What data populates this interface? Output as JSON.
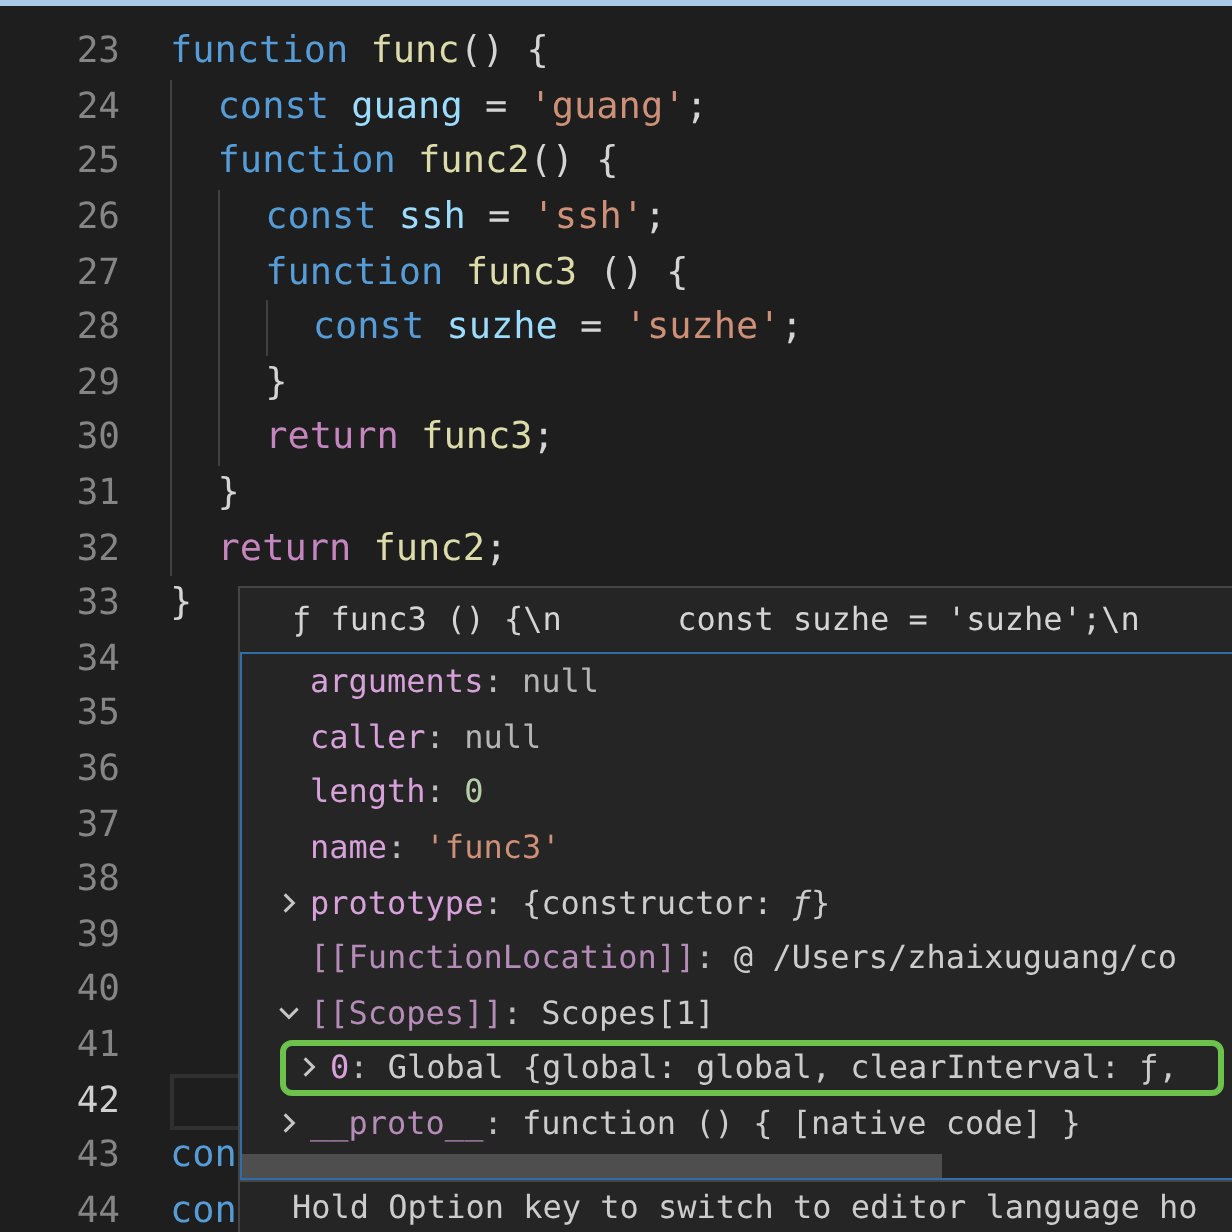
{
  "editor": {
    "lines": [
      {
        "number": "23",
        "current": false,
        "tokens": [
          {
            "text": "function",
            "kind": "keyword"
          },
          {
            "text": " func",
            "kind": "function"
          },
          {
            "text": "() {",
            "kind": "plain"
          }
        ],
        "children": [
          {
            "number": "24",
            "current": false,
            "tokens": [
              {
                "text": "const",
                "kind": "keyword"
              },
              {
                "text": " guang",
                "kind": "variable"
              },
              {
                "text": " = ",
                "kind": "plain"
              },
              {
                "text": "'guang'",
                "kind": "string"
              },
              {
                "text": ";",
                "kind": "plain"
              }
            ]
          },
          {
            "number": "25",
            "current": false,
            "tokens": [
              {
                "text": "function",
                "kind": "keyword"
              },
              {
                "text": " func2",
                "kind": "function"
              },
              {
                "text": "() {",
                "kind": "plain"
              }
            ],
            "children": [
              {
                "number": "26",
                "current": false,
                "tokens": [
                  {
                    "text": "const",
                    "kind": "keyword"
                  },
                  {
                    "text": " ssh",
                    "kind": "variable"
                  },
                  {
                    "text": " = ",
                    "kind": "plain"
                  },
                  {
                    "text": "'ssh'",
                    "kind": "string"
                  },
                  {
                    "text": ";",
                    "kind": "plain"
                  }
                ]
              },
              {
                "number": "27",
                "current": false,
                "tokens": [
                  {
                    "text": "function",
                    "kind": "keyword"
                  },
                  {
                    "text": " func3",
                    "kind": "function"
                  },
                  {
                    "text": " () {",
                    "kind": "plain"
                  }
                ],
                "children": [
                  {
                    "number": "28",
                    "current": false,
                    "tokens": [
                      {
                        "text": "const",
                        "kind": "keyword"
                      },
                      {
                        "text": " suzhe",
                        "kind": "variable"
                      },
                      {
                        "text": " = ",
                        "kind": "plain"
                      },
                      {
                        "text": "'suzhe'",
                        "kind": "string"
                      },
                      {
                        "text": ";",
                        "kind": "plain"
                      }
                    ]
                  }
                ]
              },
              {
                "number": "29",
                "current": false,
                "tokens": [
                  {
                    "text": "}",
                    "kind": "plain"
                  }
                ]
              },
              {
                "number": "30",
                "current": false,
                "tokens": [
                  {
                    "text": "return",
                    "kind": "control"
                  },
                  {
                    "text": " func3",
                    "kind": "function"
                  },
                  {
                    "text": ";",
                    "kind": "plain"
                  }
                ]
              }
            ]
          },
          {
            "number": "31",
            "current": false,
            "tokens": [
              {
                "text": "}",
                "kind": "plain"
              }
            ]
          },
          {
            "number": "32",
            "current": false,
            "tokens": [
              {
                "text": "return",
                "kind": "control"
              },
              {
                "text": " func2",
                "kind": "function"
              },
              {
                "text": ";",
                "kind": "plain"
              }
            ]
          }
        ]
      },
      {
        "number": "33",
        "current": false,
        "tokens": [
          {
            "text": "}",
            "kind": "plain"
          }
        ]
      },
      {
        "number": "34",
        "current": false
      },
      {
        "number": "35",
        "current": false
      },
      {
        "number": "36",
        "current": false
      },
      {
        "number": "37",
        "current": false
      },
      {
        "number": "38",
        "current": false
      },
      {
        "number": "39",
        "current": false
      },
      {
        "number": "40",
        "current": false
      },
      {
        "number": "41",
        "current": false
      },
      {
        "number": "42",
        "current": true
      },
      {
        "number": "43",
        "current": false,
        "tokens": [
          {
            "text": "con",
            "kind": "keyword"
          }
        ]
      },
      {
        "number": "44",
        "current": false,
        "tokens": [
          {
            "text": "con",
            "kind": "keyword"
          }
        ]
      }
    ]
  },
  "hover": {
    "header": "ƒ func3 () {\\n      const suzhe = 'suzhe';\\n",
    "items": [
      {
        "key": "arguments",
        "kind": "leaf",
        "internal": false,
        "highlighted": false,
        "value": [
          {
            "text": ": ",
            "kind": "punct"
          },
          {
            "text": "null",
            "kind": "null"
          }
        ]
      },
      {
        "key": "caller",
        "kind": "leaf",
        "internal": false,
        "highlighted": false,
        "value": [
          {
            "text": ": ",
            "kind": "punct"
          },
          {
            "text": "null",
            "kind": "null"
          }
        ]
      },
      {
        "key": "length",
        "kind": "leaf",
        "internal": false,
        "highlighted": false,
        "value": [
          {
            "text": ": ",
            "kind": "punct"
          },
          {
            "text": "0",
            "kind": "number"
          }
        ]
      },
      {
        "key": "name",
        "kind": "leaf",
        "internal": false,
        "highlighted": false,
        "value": [
          {
            "text": ": ",
            "kind": "punct"
          },
          {
            "text": "'func3'",
            "kind": "string"
          }
        ]
      },
      {
        "key": "prototype",
        "kind": "branch",
        "expanded": false,
        "internal": false,
        "highlighted": false,
        "value": [
          {
            "text": ": ",
            "kind": "punct"
          },
          {
            "text": "{constructor: *ƒ*}",
            "kind": "object"
          }
        ]
      },
      {
        "key": "[[FunctionLocation]]",
        "kind": "leaf",
        "internal": true,
        "highlighted": false,
        "value": [
          {
            "text": ": ",
            "kind": "punct"
          },
          {
            "text": "@ /Users/zhaixuguang/co",
            "kind": "object"
          }
        ]
      },
      {
        "key": "[[Scopes]]",
        "kind": "branch",
        "expanded": true,
        "internal": true,
        "highlighted": false,
        "value": [
          {
            "text": ": ",
            "kind": "punct"
          },
          {
            "text": "Scopes[1]",
            "kind": "object"
          }
        ],
        "children": [
          {
            "key": "0",
            "kind": "branch",
            "expanded": false,
            "internal": false,
            "highlighted": true,
            "value": [
              {
                "text": ": ",
                "kind": "punct"
              },
              {
                "text": "Global {global: global, clearInterval: ƒ,",
                "kind": "object"
              }
            ]
          }
        ]
      },
      {
        "key": "__proto__",
        "kind": "branch",
        "expanded": false,
        "internal": true,
        "highlighted": false,
        "value": [
          {
            "text": ": ",
            "kind": "punct"
          },
          {
            "text": "function () { [native code] }",
            "kind": "object"
          }
        ]
      }
    ],
    "footer": "Hold Option key to switch to editor language ho"
  }
}
